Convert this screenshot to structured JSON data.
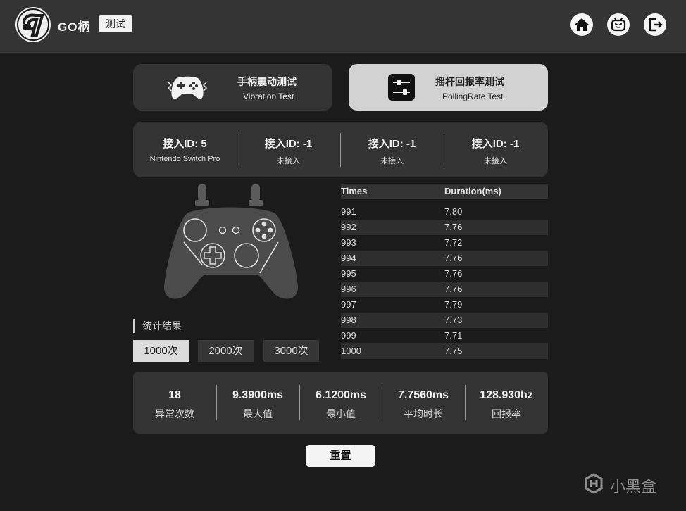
{
  "header": {
    "logo_text": "GO柄",
    "badge": "测试",
    "icons": [
      "home-icon",
      "bilibili-icon",
      "logout-icon"
    ]
  },
  "modes": [
    {
      "title": "手柄震动测试",
      "subtitle": "Vibration Test",
      "icon": "gamepad-vibrate-icon"
    },
    {
      "title": "摇杆回报率测试",
      "subtitle": "PollingRate Test",
      "icon": "sliders-icon"
    }
  ],
  "connections": [
    {
      "id_label": "接入ID: 5",
      "status": "Nintendo Switch Pro"
    },
    {
      "id_label": "接入ID: -1",
      "status": "未接入"
    },
    {
      "id_label": "接入ID: -1",
      "status": "未接入"
    },
    {
      "id_label": "接入ID: -1",
      "status": "未接入"
    }
  ],
  "stats": {
    "heading": "统计结果",
    "options": [
      "1000次",
      "2000次",
      "3000次"
    ],
    "selected": "1000次"
  },
  "table": {
    "headers": [
      "Times",
      "Duration(ms)"
    ],
    "rows": [
      [
        "991",
        "7.80"
      ],
      [
        "992",
        "7.76"
      ],
      [
        "993",
        "7.72"
      ],
      [
        "994",
        "7.76"
      ],
      [
        "995",
        "7.76"
      ],
      [
        "996",
        "7.76"
      ],
      [
        "997",
        "7.79"
      ],
      [
        "998",
        "7.73"
      ],
      [
        "999",
        "7.71"
      ],
      [
        "1000",
        "7.75"
      ]
    ]
  },
  "summary": [
    {
      "value": "18",
      "label": "异常次数"
    },
    {
      "value": "9.3900ms",
      "label": "最大值"
    },
    {
      "value": "6.1200ms",
      "label": "最小值"
    },
    {
      "value": "7.7560ms",
      "label": "平均时长"
    },
    {
      "value": "128.930hz",
      "label": "回报率"
    }
  ],
  "reset_label": "重置",
  "watermark": "小黑盒",
  "colors": {
    "background": "#1b1b1b",
    "panel": "#333333",
    "active_card": "#d2d2d2",
    "topbar": "#343434"
  }
}
